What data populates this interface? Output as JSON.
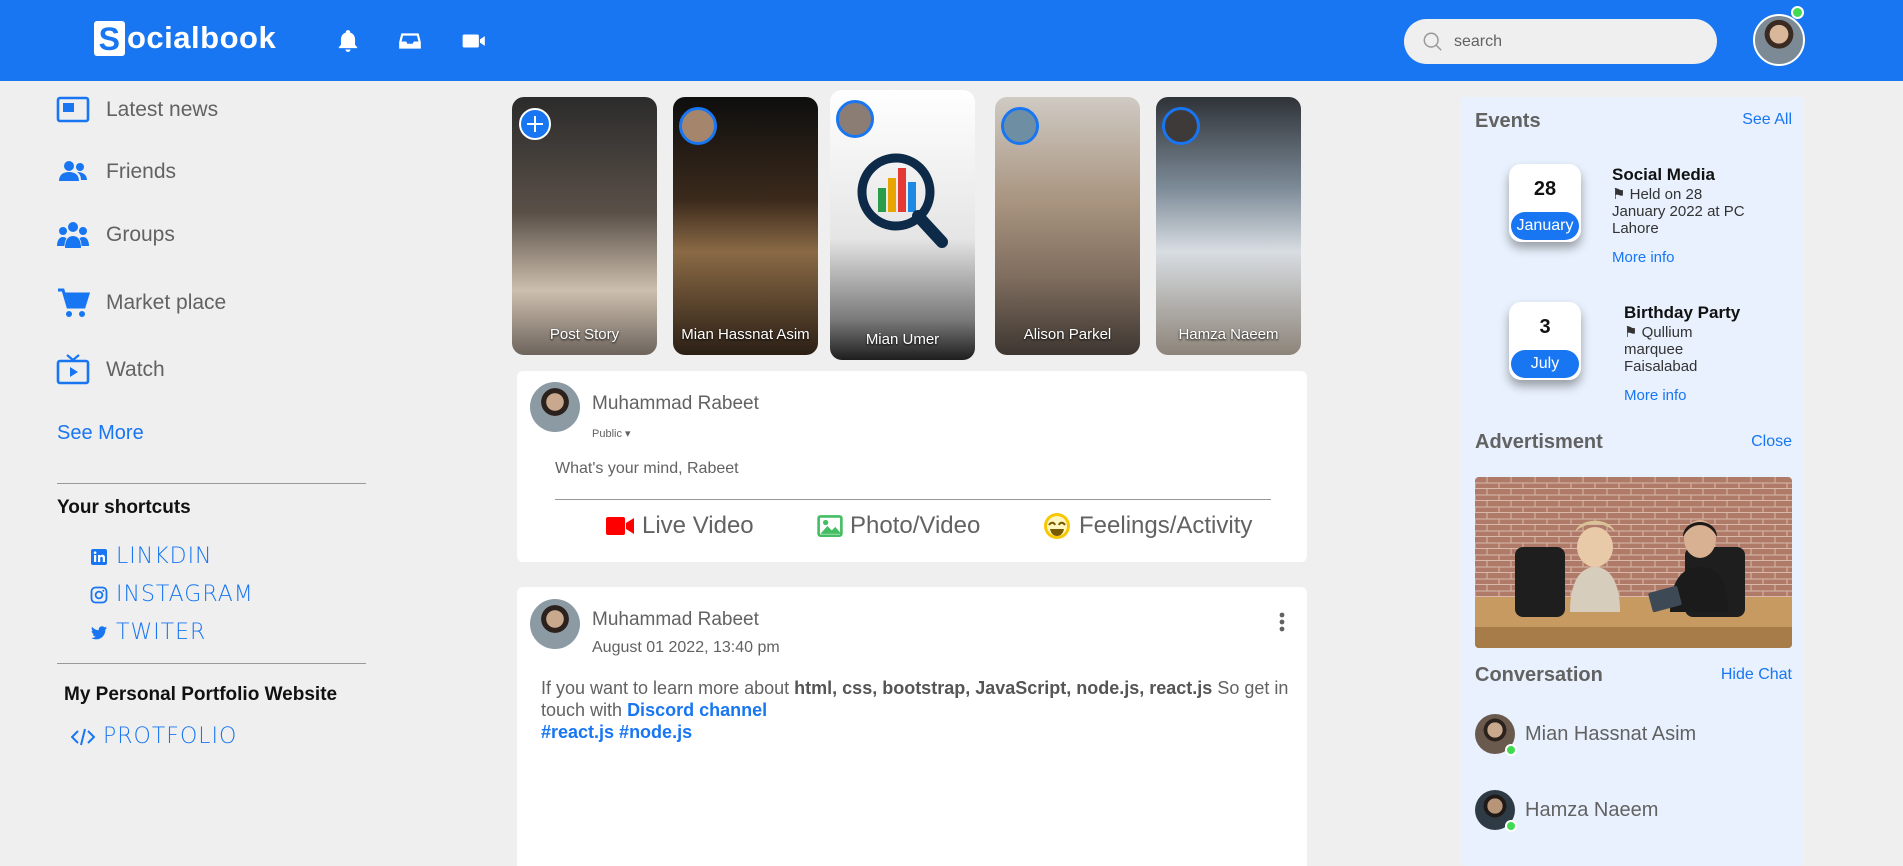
{
  "navbar": {
    "logo_initial": "S",
    "logo_rest": "ocialbook",
    "icons": [
      "bell-icon",
      "inbox-icon",
      "video-icon"
    ],
    "search_placeholder": "search",
    "accent": "#1876f2"
  },
  "left_menu": {
    "items": [
      {
        "label": "Latest news",
        "icon": "newspaper-icon"
      },
      {
        "label": "Friends",
        "icon": "friends-icon"
      },
      {
        "label": "Groups",
        "icon": "groups-icon"
      },
      {
        "label": "Market place",
        "icon": "cart-icon"
      },
      {
        "label": "Watch",
        "icon": "tv-icon"
      }
    ],
    "see_more": "See More",
    "shortcuts_title": "Your shortcuts",
    "shortcuts": [
      {
        "label": "LINKDIN",
        "icon": "linkedin-icon"
      },
      {
        "label": "INSTAGRAM",
        "icon": "instagram-icon"
      },
      {
        "label": "TWITER",
        "icon": "twitter-icon"
      }
    ],
    "portfolio_title": "My Personal Portfolio Website",
    "portfolio_link": "PROTFOLIO"
  },
  "stories": [
    {
      "caption": "Post Story",
      "icon": "plus-circle-icon"
    },
    {
      "caption": "Mian Hassnat Asim"
    },
    {
      "caption": "Mian Umer"
    },
    {
      "caption": "Alison Parkel"
    },
    {
      "caption": "Hamza Naeem"
    }
  ],
  "composer": {
    "user_name": "Muhammad Rabeet",
    "privacy": "Public",
    "placeholder": "What's your mind, Rabeet",
    "actions": [
      {
        "label": "Live Video",
        "icon": "live-video-icon"
      },
      {
        "label": "Photo/Video",
        "icon": "photo-icon"
      },
      {
        "label": "Feelings/Activity",
        "icon": "smile-icon"
      }
    ]
  },
  "post": {
    "user_name": "Muhammad Rabeet",
    "timestamp": "August 01 2022, 13:40 pm",
    "text_intro": "If you want to learn more about",
    "text_bold": "html, css, bootstrap, JavaScript, node.js, react.js",
    "text_mid": "So get in touch with",
    "link": "Discord channel",
    "hashtags": "#react.js #node.js"
  },
  "events": {
    "title": "Events",
    "see_all": "See All",
    "items": [
      {
        "day": "28",
        "month": "January",
        "title": "Social Media",
        "desc": "Held on 28 January 2022 at PC Lahore",
        "more": "More info"
      },
      {
        "day": "3",
        "month": "July",
        "title": "Birthday Party",
        "desc": "Qullium marquee Faisalabad",
        "more": "More info"
      }
    ]
  },
  "advertisement": {
    "title": "Advertisment",
    "close": "Close"
  },
  "conversation": {
    "title": "Conversation",
    "hide": "Hide Chat",
    "contacts": [
      "Mian Hassnat Asim",
      "Hamza Naeem"
    ]
  }
}
